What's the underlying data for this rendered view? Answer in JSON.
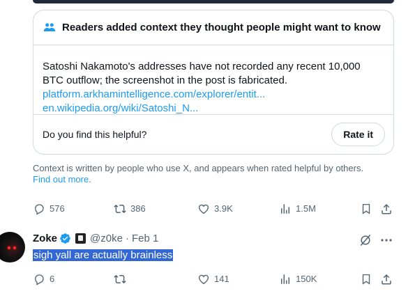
{
  "note": {
    "title": "Readers added context they thought people might want to know",
    "body_line1": "Satoshi Nakamoto's addresses have not recorded any recent 10,000",
    "body_line2": "BTC outflow; the screenshot in the post is fabricated.",
    "link1": "platform.arkhamintelligence.com/explorer/entit...",
    "link2": "en.wikipedia.org/wiki/Satoshi_N...",
    "helpful_question": "Do you find this helpful?",
    "rate_button": "Rate it"
  },
  "context_info": {
    "text": "Context is written by people who use X, and appears when rated helpful by others.",
    "link": "Find out more",
    "suffix": "."
  },
  "main_post_actions": {
    "replies": "576",
    "reposts": "386",
    "likes": "3.9K",
    "views": "1.5M"
  },
  "reply": {
    "display_name": "Zoke",
    "handle": "@z0ke",
    "separator": "·",
    "date": "Feb 1",
    "text": "sigh yall are actually brainless",
    "actions": {
      "replies": "6",
      "reposts": "",
      "likes": "141",
      "views": "150K"
    }
  },
  "colors": {
    "accent": "#1d9bf0",
    "secondary_text": "#536471",
    "border": "#cfd9de",
    "selection": "#3367d6"
  },
  "icons": [
    "community-notes-icon",
    "reply-icon",
    "repost-icon",
    "like-icon",
    "views-icon",
    "bookmark-icon",
    "share-icon",
    "verified-badge-icon",
    "grok-icon",
    "more-icon"
  ]
}
